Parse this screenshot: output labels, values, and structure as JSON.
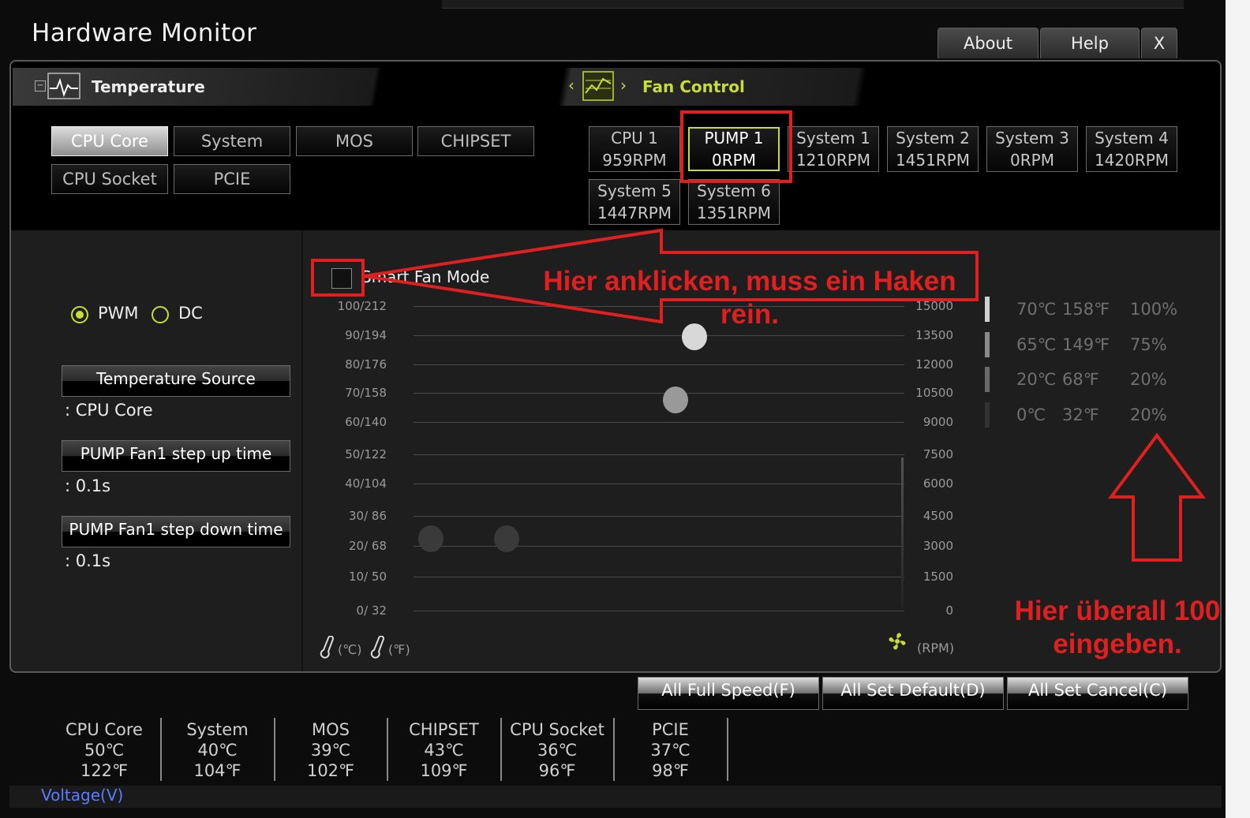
{
  "window": {
    "title": "Hardware Monitor",
    "buttons": [
      "About",
      "Help",
      "X"
    ]
  },
  "temperature_panel": {
    "header": "Temperature",
    "sensors": [
      "CPU Core",
      "System",
      "MOS",
      "CHIPSET",
      "CPU Socket",
      "PCIE"
    ],
    "selected": "CPU Core"
  },
  "fan_panel": {
    "header": "Fan Control",
    "fans": [
      {
        "name": "CPU 1",
        "rpm": "959RPM"
      },
      {
        "name": "PUMP 1",
        "rpm": "0RPM"
      },
      {
        "name": "System 1",
        "rpm": "1210RPM"
      },
      {
        "name": "System 2",
        "rpm": "1451RPM"
      },
      {
        "name": "System 3",
        "rpm": "0RPM"
      },
      {
        "name": "System 4",
        "rpm": "1420RPM"
      },
      {
        "name": "System 5",
        "rpm": "1447RPM"
      },
      {
        "name": "System 6",
        "rpm": "1351RPM"
      }
    ],
    "selected": "PUMP 1"
  },
  "settings": {
    "mode_pwm": "PWM",
    "mode_dc": "DC",
    "mode_selected": "PWM",
    "temp_source_label": "Temperature Source",
    "temp_source_value": ": CPU Core",
    "step_up_label": "PUMP Fan1 step up time",
    "step_up_value": ": 0.1s",
    "step_down_label": "PUMP Fan1 step down time",
    "step_down_value": ": 0.1s"
  },
  "chart": {
    "smart_fan_label": "Smart Fan Mode",
    "smart_fan_checked": false,
    "left_ticks": [
      "100/212",
      "90/194",
      "80/176",
      "70/158",
      "60/140",
      "50/122",
      "40/104",
      "30/  86",
      "20/  68",
      "10/  50",
      "0/  32"
    ],
    "right_ticks": [
      "15000",
      "13500",
      "12000",
      "10500",
      "9000",
      "7500",
      "6000",
      "4500",
      "3000",
      "1500",
      "0"
    ],
    "unit_c": "(℃)",
    "unit_f": "(℉)",
    "unit_rpm": "(RPM)"
  },
  "chart_data": {
    "type": "scatter",
    "title": "Smart Fan Mode",
    "xlabel": "",
    "ylabel": "(℃) (℉)",
    "ylim": [
      0,
      100
    ],
    "y2label": "(RPM)",
    "y2lim": [
      0,
      15000
    ],
    "grid": true,
    "points": [
      {
        "temp_c": 20,
        "duty_percent": 20
      },
      {
        "temp_c": 20,
        "duty_percent": 20
      },
      {
        "temp_c": 65,
        "duty_percent": 75
      },
      {
        "temp_c": 70,
        "duty_percent": 100
      }
    ]
  },
  "right_table": [
    {
      "c": "70℃",
      "f": "158℉",
      "p": "100%"
    },
    {
      "c": "65℃",
      "f": "149℉",
      "p": "75%"
    },
    {
      "c": "20℃",
      "f": "68℉",
      "p": "20%"
    },
    {
      "c": "0℃",
      "f": "32℉",
      "p": "20%"
    }
  ],
  "bottom_buttons": [
    "All Full Speed(F)",
    "All Set Default(D)",
    "All Set Cancel(C)"
  ],
  "status": [
    {
      "name": "CPU Core",
      "c": "50℃",
      "f": "122℉"
    },
    {
      "name": "System",
      "c": "40℃",
      "f": "104℉"
    },
    {
      "name": "MOS",
      "c": "39℃",
      "f": "102℉"
    },
    {
      "name": "CHIPSET",
      "c": "43℃",
      "f": "109℉"
    },
    {
      "name": "CPU Socket",
      "c": "36℃",
      "f": "96℉"
    },
    {
      "name": "PCIE",
      "c": "37℃",
      "f": "98℉"
    }
  ],
  "voltage_label": "Voltage(V)",
  "annotations": {
    "click_here_line1": "Hier anklicken, muss ein Haken",
    "click_here_line2": "rein.",
    "enter_100_line1": "Hier überall 100",
    "enter_100_line2": "eingeben."
  },
  "colors": {
    "accent": "#c8dc38",
    "annotation": "#e02020",
    "voltage": "#5a7cff"
  }
}
